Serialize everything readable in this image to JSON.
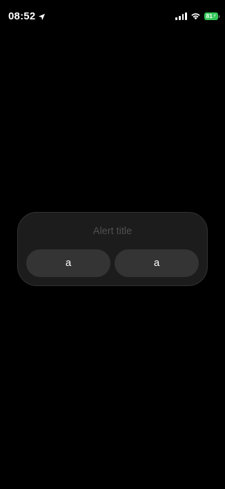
{
  "status_bar": {
    "time": "08:52",
    "location_icon": "location-arrow-icon",
    "signal_icon": "cellular-signal-icon",
    "wifi_icon": "wifi-icon",
    "battery_level": "81",
    "battery_color": "#34c759"
  },
  "alert": {
    "title": "Alert title",
    "buttons": [
      {
        "label": "a"
      },
      {
        "label": "a"
      }
    ]
  }
}
